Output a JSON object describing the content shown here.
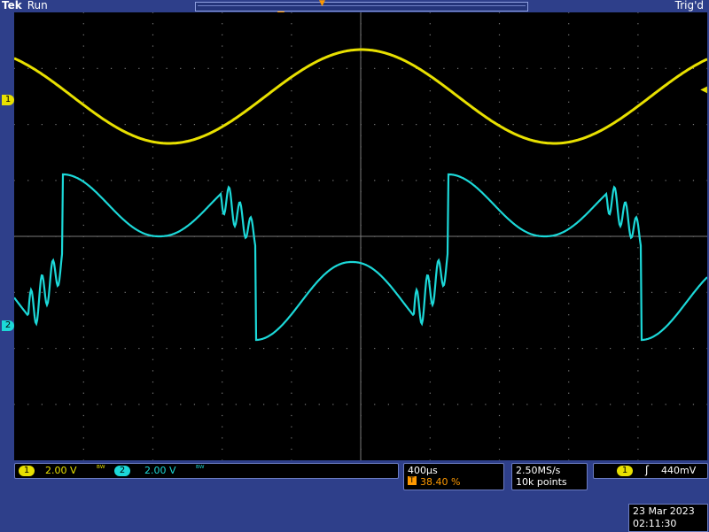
{
  "header": {
    "brand": "Tek",
    "run_state": "Run",
    "trigger_status": "Trig'd"
  },
  "markers": {
    "trigger_position_icon": "T-marker",
    "channel1": "1",
    "channel2": "2",
    "trigger_level_icon": "left-arrow"
  },
  "channels": [
    {
      "id": "1",
      "scale": "2.00 V",
      "color": "#e8e000",
      "bw_icon": "bandwidth-limit-icon"
    },
    {
      "id": "2",
      "scale": "2.00 V",
      "color": "#1cd8d8",
      "bw_icon": "bandwidth-limit-icon"
    }
  ],
  "timebase": {
    "scale": "400µs",
    "trigger_pos_icon": "T",
    "trigger_pos": "38.40 %"
  },
  "acquisition": {
    "sample_rate": "2.50MS/s",
    "record_length": "10k points"
  },
  "trigger": {
    "source": "1",
    "slope_icon": "rising-edge-icon",
    "slope": "ʃ",
    "level": "440mV"
  },
  "datetime": {
    "date": "23 Mar  2023",
    "time": "02:11:30"
  },
  "colors": {
    "background": "#2e3f8a",
    "screen": "#000000",
    "grid": "#7a7a7a",
    "ch1": "#e8e000",
    "ch2": "#1cd8d8",
    "trigger": "#ff9900"
  }
}
